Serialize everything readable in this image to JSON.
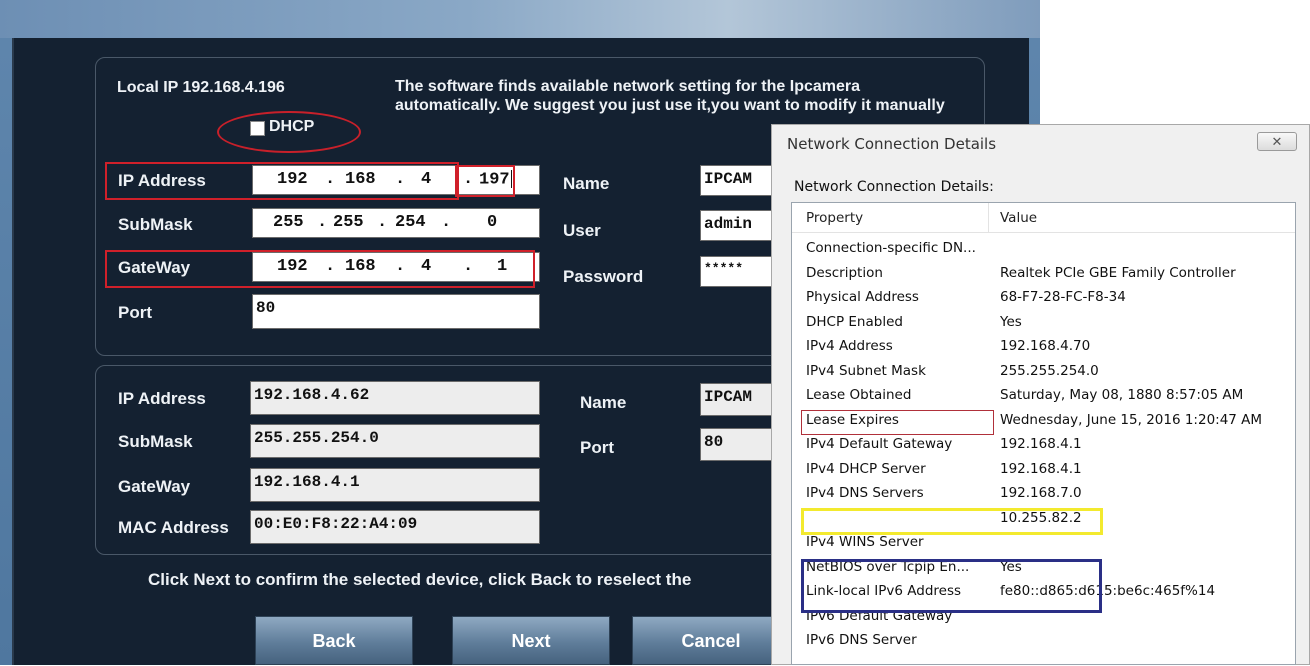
{
  "setup": {
    "local_ip_label": "Local IP 192.168.4.196",
    "note": "The software finds available network setting for the Ipcamera automatically. We suggest you just use it,you want to modify it manually",
    "dhcp_label": "DHCP",
    "dhcp_checked": false,
    "fields": {
      "ip_label": "IP Address",
      "ip": [
        "192",
        "168",
        "4",
        "197"
      ],
      "submask_label": "SubMask",
      "submask": [
        "255",
        "255",
        "254",
        "0"
      ],
      "gateway_label": "GateWay",
      "gateway": [
        "192",
        "168",
        "4",
        "1"
      ],
      "port_label": "Port",
      "port": "80",
      "name_label": "Name",
      "name": "IPCAM",
      "user_label": "User",
      "user": "admin",
      "password_label": "Password",
      "password": "*****"
    },
    "device": {
      "ip_label": "IP Address",
      "ip": "192.168.4.62",
      "submask_label": "SubMask",
      "submask": "255.255.254.0",
      "gateway_label": "GateWay",
      "gateway": "192.168.4.1",
      "mac_label": "MAC Address",
      "mac": "00:E0:F8:22:A4:09",
      "name_label": "Name",
      "name": "IPCAM",
      "port_label": "Port",
      "port": "80"
    },
    "bottom_message": "Click Next to confirm the selected device, click Back to reselect the",
    "buttons": {
      "back": "Back",
      "next": "Next",
      "cancel": "Cancel"
    },
    "highlight_color": "#d0202a"
  },
  "ncd": {
    "title": "Network Connection Details",
    "close_glyph": "✕",
    "label": "Network Connection Details:",
    "col_property": "Property",
    "col_value": "Value",
    "rows": [
      {
        "p": "Connection-specific DN...",
        "v": ""
      },
      {
        "p": "Description",
        "v": "Realtek PCIe GBE Family Controller"
      },
      {
        "p": "Physical Address",
        "v": "68-F7-28-FC-F8-34"
      },
      {
        "p": "DHCP Enabled",
        "v": "Yes"
      },
      {
        "p": "IPv4 Address",
        "v": "192.168.4.70"
      },
      {
        "p": "IPv4 Subnet Mask",
        "v": "255.255.254.0"
      },
      {
        "p": "Lease Obtained",
        "v": "Saturday, May 08, 1880 8:57:05 AM"
      },
      {
        "p": "Lease Expires",
        "v": "Wednesday, June 15, 2016 1:20:47 AM"
      },
      {
        "p": "IPv4 Default Gateway",
        "v": "192.168.4.1"
      },
      {
        "p": "IPv4 DHCP Server",
        "v": "192.168.4.1"
      },
      {
        "p": "IPv4 DNS Servers",
        "v": "192.168.7.0"
      },
      {
        "p": "",
        "v": "10.255.82.2"
      },
      {
        "p": "IPv4 WINS Server",
        "v": ""
      },
      {
        "p": "NetBIOS over Tcpip En...",
        "v": "Yes"
      },
      {
        "p": "Link-local IPv6 Address",
        "v": "fe80::d865:d615:be6c:465f%14"
      },
      {
        "p": "IPv6 Default Gateway",
        "v": ""
      },
      {
        "p": "IPv6 DNS Server",
        "v": ""
      }
    ],
    "highlight_colors": {
      "ipv4": "#b0303a",
      "gateway": "#f3ea2e",
      "dns": "#2a2f86"
    }
  }
}
